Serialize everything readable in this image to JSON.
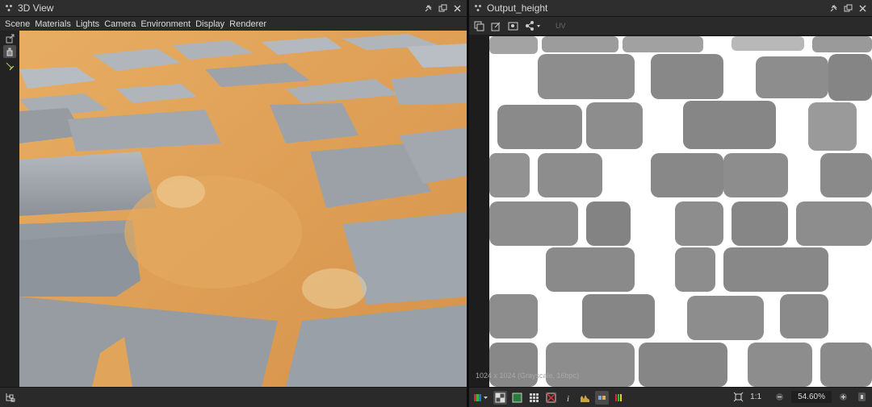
{
  "left_panel": {
    "title": "3D View",
    "menu": [
      "Scene",
      "Materials",
      "Lights",
      "Camera",
      "Environment",
      "Display",
      "Renderer"
    ]
  },
  "right_panel": {
    "title": "Output_height",
    "uv_dropdown": "UV",
    "image_info": "1024 x 1024 (Grayscale, 16bpc)",
    "zoom_ratio_label": "1:1",
    "zoom_value": "54.60%"
  },
  "icons": {
    "window_pin": "pin-icon",
    "window_float": "float-icon",
    "window_close": "close-icon",
    "tool_camera": "camera-icon",
    "tool_light": "light-icon"
  },
  "colors": {
    "panel_bg": "#262626",
    "titlebar": "#2e2e2e",
    "sand": "#dea259",
    "stone": "#9aa1a8",
    "height_white": "#ffffff"
  }
}
